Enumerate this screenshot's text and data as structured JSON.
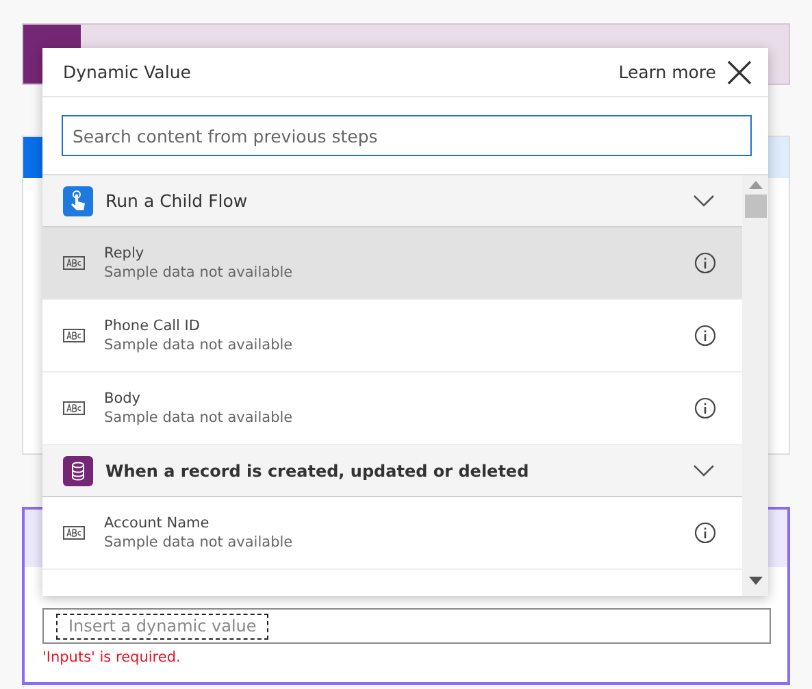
{
  "popup": {
    "title": "Dynamic Value",
    "learn_more": "Learn more",
    "search": {
      "placeholder": "Search content from previous steps"
    },
    "groups": [
      {
        "title": "Run a Child Flow",
        "kind": "child-flow",
        "expanded": true,
        "items": [
          {
            "name": "Reply",
            "subtitle": "Sample data not available",
            "selected": true
          },
          {
            "name": "Phone Call ID",
            "subtitle": "Sample data not available",
            "selected": false
          },
          {
            "name": "Body",
            "subtitle": "Sample data not available",
            "selected": false
          }
        ]
      },
      {
        "title": "When a record is created, updated or deleted",
        "kind": "dataverse",
        "expanded": true,
        "items": [
          {
            "name": "Account Name",
            "subtitle": "Sample data not available",
            "selected": false
          }
        ]
      }
    ]
  },
  "inputs_card": {
    "placeholder": "Insert a dynamic value",
    "error": "'Inputs' is required."
  }
}
